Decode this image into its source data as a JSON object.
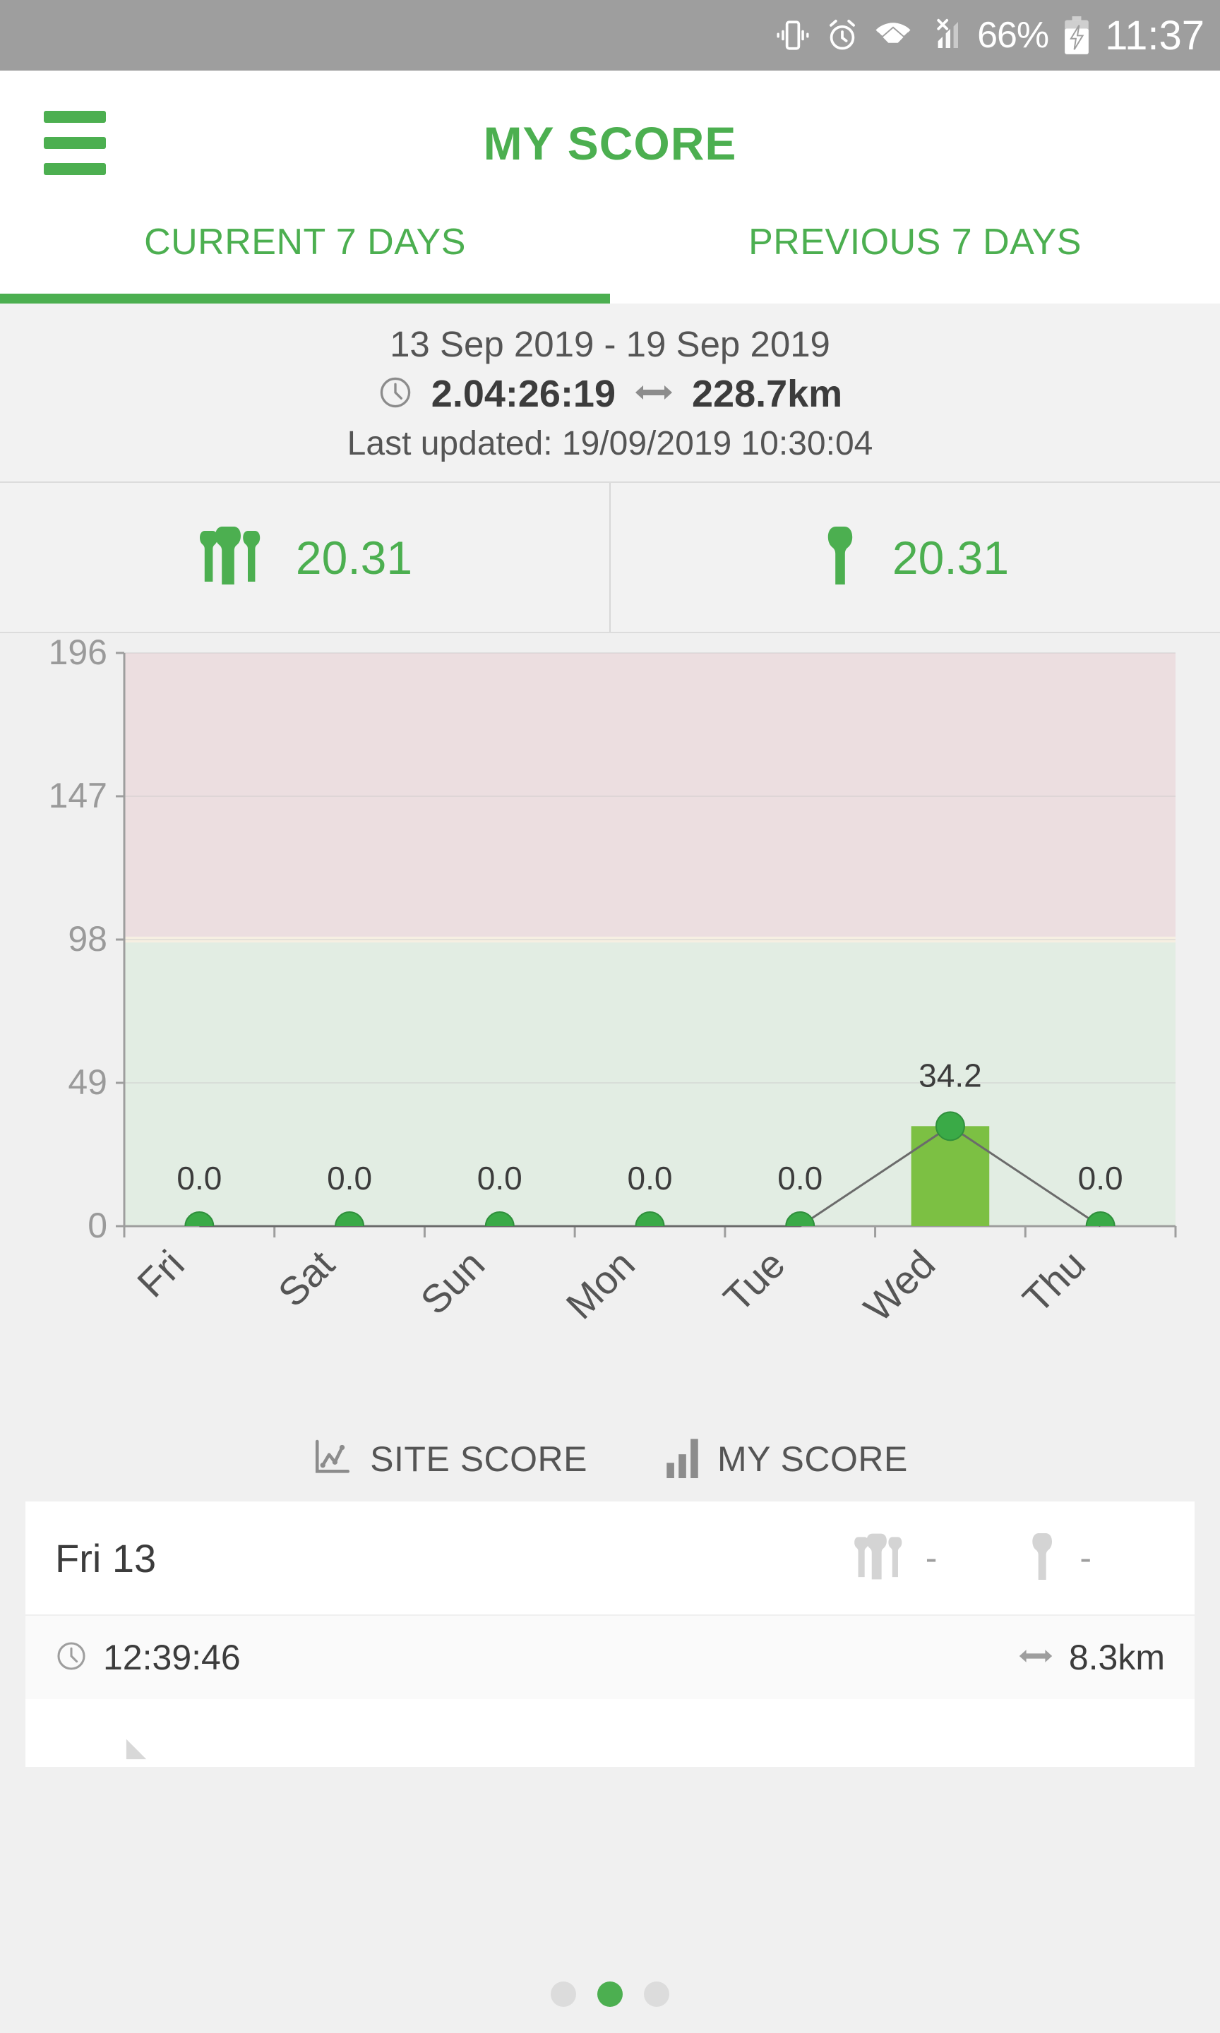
{
  "status_bar": {
    "icons": [
      "vibrate-icon",
      "alarm-icon",
      "wifi-icon",
      "signal-no-sim-icon"
    ],
    "battery_percent": "66%",
    "battery_state": "charging",
    "clock": "11:37"
  },
  "app_bar": {
    "menu_icon": "hamburger-menu-icon",
    "title": "MY SCORE",
    "accent_color": "#4caf50"
  },
  "tabs": [
    {
      "label": "CURRENT 7 DAYS",
      "active": true
    },
    {
      "label": "PREVIOUS 7 DAYS",
      "active": false
    }
  ],
  "summary": {
    "date_range": "13 Sep 2019 - 19 Sep 2019",
    "duration_icon": "clock-icon",
    "duration": "2.04:26:19",
    "distance_icon": "distance-arrows-icon",
    "distance": "228.7km",
    "last_updated": "Last updated: 19/09/2019 10:30:04"
  },
  "score_row": [
    {
      "icon": "group-people-icon",
      "label": "site-score",
      "value": "20.31"
    },
    {
      "icon": "single-person-icon",
      "label": "my-score",
      "value": "20.31"
    }
  ],
  "legend": [
    {
      "icon": "line-chart-icon",
      "label": "SITE SCORE"
    },
    {
      "icon": "bar-chart-icon",
      "label": "MY SCORE"
    }
  ],
  "day_card": {
    "date": "Fri 13",
    "site_score_icon": "group-people-icon",
    "site_score": "-",
    "my_score_icon": "single-person-icon",
    "my_score": "-",
    "row": {
      "duration_icon": "clock-icon",
      "duration": "12:39:46",
      "distance_icon": "distance-arrows-icon",
      "distance": "8.3km"
    }
  },
  "pager": {
    "count": 3,
    "active_index": 1
  },
  "chart_data": {
    "type": "bar",
    "title": "",
    "xlabel": "",
    "ylabel": "",
    "categories": [
      "Fri",
      "Sat",
      "Sun",
      "Mon",
      "Tue",
      "Wed",
      "Thu"
    ],
    "ylim": [
      0,
      196
    ],
    "yticks": [
      0,
      49,
      98,
      147,
      196
    ],
    "ytick_labels": [
      "0",
      "49",
      "98",
      "147",
      "196"
    ],
    "grid": true,
    "legend_position": "below",
    "series": [
      {
        "name": "MY SCORE",
        "type": "bar",
        "color": "#7cc043",
        "values": [
          0.0,
          0.0,
          0.0,
          0.0,
          0.0,
          34.2,
          0.0
        ]
      },
      {
        "name": "SITE SCORE",
        "type": "line",
        "color": "#3aaa47",
        "line_color": "#6b6b6b",
        "values": [
          0.0,
          0.0,
          0.0,
          0.0,
          0.0,
          34.2,
          0.0
        ],
        "point_labels": [
          "0.0",
          "0.0",
          "0.0",
          "0.0",
          "0.0",
          "34.2",
          "0.0"
        ]
      }
    ],
    "bands": [
      {
        "name": "safe-zone",
        "from": 0,
        "to": 97,
        "color": "#e2ede3"
      },
      {
        "name": "warning-zone",
        "from": 97,
        "to": 99,
        "color": "#f6efe2"
      },
      {
        "name": "danger-zone",
        "from": 99,
        "to": 196,
        "color": "#ecdee0"
      }
    ]
  }
}
